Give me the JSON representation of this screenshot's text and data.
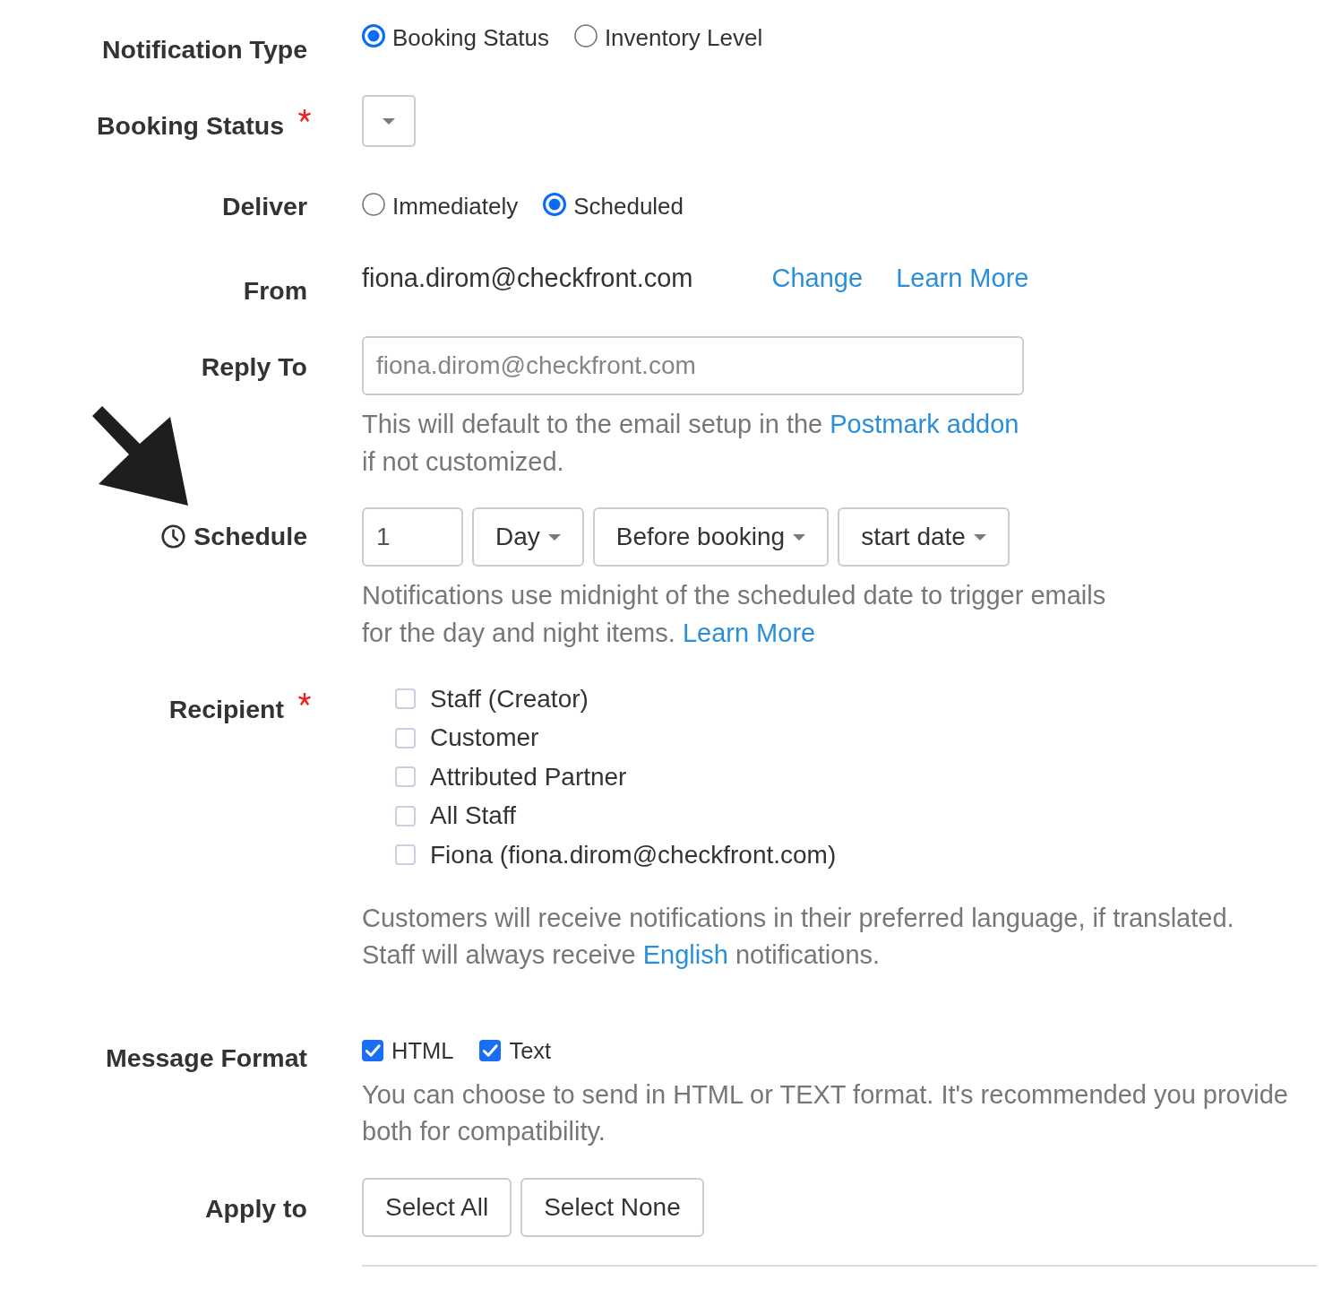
{
  "fields": [
    {
      "kind": "radio",
      "label": "Notification Type",
      "required": false,
      "options": [
        {
          "label": "Booking Status",
          "selected": true
        },
        {
          "label": "Inventory Level",
          "selected": false
        }
      ]
    },
    {
      "kind": "select",
      "label": "Booking Status",
      "required": true
    },
    {
      "kind": "radio",
      "label": "Deliver",
      "required": false,
      "options": [
        {
          "label": "Immediately",
          "selected": false
        },
        {
          "label": "Scheduled",
          "selected": true
        }
      ]
    },
    {
      "kind": "text",
      "label": "From",
      "required": false,
      "value": "fiona.dirom@checkfront.com",
      "links": [
        "Change",
        "Learn More"
      ]
    },
    {
      "kind": "input",
      "label": "Reply To",
      "required": false,
      "placeholder": "fiona.dirom@checkfront.com",
      "help": [
        [
          {
            "kind": "text",
            "text": "This will default to the email setup in the "
          },
          {
            "kind": "link",
            "text": "Postmark addon"
          }
        ],
        [
          {
            "kind": "text",
            "text": "if not customized."
          }
        ]
      ]
    },
    {
      "kind": "schedule",
      "label": "Schedule",
      "required": false,
      "value": "1",
      "selects": [
        "Day",
        "Before booking",
        "start date"
      ],
      "help": [
        [
          {
            "kind": "text",
            "text": "Notifications use midnight of the scheduled date to trigger emails"
          }
        ],
        [
          {
            "kind": "text",
            "text": "for the day and night items. "
          },
          {
            "kind": "link",
            "text": "Learn More"
          }
        ]
      ]
    },
    {
      "kind": "checklist",
      "label": "Recipient",
      "required": true,
      "options": [
        {
          "label": "Staff (Creator)",
          "checked": false
        },
        {
          "label": "Customer",
          "checked": false
        },
        {
          "label": "Attributed Partner",
          "checked": false
        },
        {
          "label": "All Staff",
          "checked": false
        },
        {
          "label": "Fiona (fiona.dirom@checkfront.com)",
          "checked": false
        }
      ],
      "help": [
        [
          {
            "kind": "text",
            "text": "Customers will receive notifications in their preferred language, if translated."
          }
        ],
        [
          {
            "kind": "text",
            "text": "Staff will always receive "
          },
          {
            "kind": "link",
            "text": "English"
          },
          {
            "kind": "text",
            "text": " notifications."
          }
        ]
      ]
    },
    {
      "kind": "checkbox_row",
      "label": "Message Format",
      "required": false,
      "options": [
        {
          "label": "HTML",
          "checked": true
        },
        {
          "label": "Text",
          "checked": true
        }
      ],
      "help": [
        [
          {
            "kind": "text",
            "text": "You can choose to send in HTML or TEXT format. It's recommended you provide"
          }
        ],
        [
          {
            "kind": "text",
            "text": "both for compatibility."
          }
        ]
      ]
    },
    {
      "kind": "buttons",
      "label": "Apply to",
      "required": false,
      "buttons": [
        "Select All",
        "Select None"
      ]
    }
  ]
}
